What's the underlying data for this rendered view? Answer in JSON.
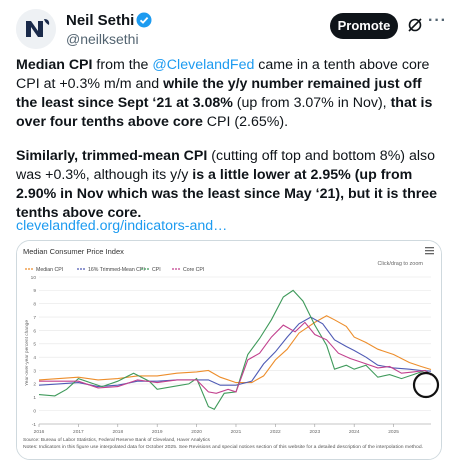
{
  "author": {
    "name": "Neil Sethi",
    "handle": "@neilksethi"
  },
  "header": {
    "promote_label": "Promote",
    "more_label": "···",
    "grok_icon": "grok-icon",
    "verified_color": "#1d9bf0"
  },
  "tweet": {
    "p1": [
      {
        "t": "Median CPI",
        "b": true
      },
      {
        "t": " from the "
      },
      {
        "t": "@ClevelandFed",
        "link": true
      },
      {
        "t": " came in a tenth above core CPI at +0.3% m/m and "
      },
      {
        "t": "while the y/y number remained just off the least since Sept ‘21 at 3.08%",
        "b": true
      },
      {
        "t": " (up from 3.07% in Nov), "
      },
      {
        "t": "that is over four tenths above core",
        "b": true
      },
      {
        "t": " CPI (2.65%)."
      }
    ],
    "p2": [
      {
        "t": "Similarly, trimmed-mean CPI",
        "b": true
      },
      {
        "t": " (cutting off top and bottom 8%) also was +0.3%, although its y/y "
      },
      {
        "t": "is a little lower at 2.95% (up from 2.90% in Nov which was the least since May ‘21), but it is three tenths above core.",
        "b": true
      }
    ],
    "link_text": "clevelandfed.org/indicators-and…"
  },
  "chart": {
    "title": "Median Consumer Price Index",
    "menu_icon": "hamburger-menu-icon",
    "zoom_hint": "Click/drag to zoom",
    "ylabel": "Year-over-year percent change",
    "source_line1": "Source: Bureau of Labor Statistics, Federal Reserve Bank of Cleveland, Haver Analytics",
    "source_line2": "Notes: Indicators in this figure use interpolated data for October 2025. See Revisions and special notices section of this website for a detailed description of the interpolation method."
  },
  "chart_data": {
    "type": "line",
    "title": "Median Consumer Price Index",
    "ylabel": "Year-over-year percent change",
    "ylim": [
      -1,
      10
    ],
    "y_ticks": [
      -1,
      0,
      1,
      2,
      3,
      4,
      5,
      6,
      7,
      8,
      9,
      10
    ],
    "xlim": [
      2016,
      2025.95
    ],
    "x_ticks": [
      "2016",
      "2017",
      "2018",
      "2019",
      "2020",
      "2021",
      "2022",
      "2023",
      "2024",
      "2025"
    ],
    "legend_position": "top-left",
    "grid": true,
    "series": [
      {
        "name": "Median CPI",
        "color": "#ed8e2c",
        "points": [
          [
            2016,
            2.3
          ],
          [
            2016.5,
            2.4
          ],
          [
            2017,
            2.5
          ],
          [
            2017.5,
            2.3
          ],
          [
            2018,
            2.4
          ],
          [
            2018.5,
            2.6
          ],
          [
            2019,
            2.6
          ],
          [
            2019.5,
            2.8
          ],
          [
            2020,
            2.9
          ],
          [
            2020.3,
            3.0
          ],
          [
            2020.6,
            2.5
          ],
          [
            2021,
            2.1
          ],
          [
            2021.4,
            2.1
          ],
          [
            2021.7,
            2.6
          ],
          [
            2022,
            3.8
          ],
          [
            2022.3,
            4.6
          ],
          [
            2022.6,
            5.8
          ],
          [
            2023,
            6.6
          ],
          [
            2023.3,
            7.1
          ],
          [
            2023.5,
            6.8
          ],
          [
            2023.8,
            6.3
          ],
          [
            2024,
            5.5
          ],
          [
            2024.3,
            5.1
          ],
          [
            2024.6,
            4.6
          ],
          [
            2025,
            4.2
          ],
          [
            2025.4,
            3.6
          ],
          [
            2025.7,
            3.3
          ],
          [
            2025.95,
            3.08
          ]
        ]
      },
      {
        "name": "16% Trimmed-Mean CPI",
        "color": "#4f5bb5",
        "points": [
          [
            2016,
            1.9
          ],
          [
            2016.5,
            2.0
          ],
          [
            2017,
            2.1
          ],
          [
            2017.5,
            1.8
          ],
          [
            2018,
            1.9
          ],
          [
            2018.5,
            2.2
          ],
          [
            2019,
            2.2
          ],
          [
            2019.5,
            2.3
          ],
          [
            2020,
            2.3
          ],
          [
            2020.3,
            2.3
          ],
          [
            2020.6,
            1.9
          ],
          [
            2021,
            1.9
          ],
          [
            2021.4,
            2.2
          ],
          [
            2021.7,
            3.5
          ],
          [
            2022,
            4.4
          ],
          [
            2022.3,
            5.5
          ],
          [
            2022.6,
            6.5
          ],
          [
            2022.9,
            7.0
          ],
          [
            2023.2,
            6.5
          ],
          [
            2023.5,
            5.3
          ],
          [
            2023.8,
            4.8
          ],
          [
            2024,
            4.5
          ],
          [
            2024.3,
            4.0
          ],
          [
            2024.6,
            3.4
          ],
          [
            2025,
            3.2
          ],
          [
            2025.4,
            3.1
          ],
          [
            2025.7,
            3.0
          ],
          [
            2025.95,
            2.95
          ]
        ]
      },
      {
        "name": "CPI",
        "color": "#3f9a5b",
        "points": [
          [
            2016,
            1.2
          ],
          [
            2016.4,
            1.1
          ],
          [
            2016.7,
            1.6
          ],
          [
            2017,
            2.4
          ],
          [
            2017.3,
            2.1
          ],
          [
            2017.6,
            1.8
          ],
          [
            2018,
            2.2
          ],
          [
            2018.4,
            2.8
          ],
          [
            2018.8,
            2.2
          ],
          [
            2019,
            1.6
          ],
          [
            2019.4,
            1.8
          ],
          [
            2019.8,
            2.0
          ],
          [
            2020,
            2.4
          ],
          [
            2020.3,
            0.3
          ],
          [
            2020.45,
            0.1
          ],
          [
            2020.7,
            1.3
          ],
          [
            2021,
            1.4
          ],
          [
            2021.3,
            4.2
          ],
          [
            2021.6,
            5.4
          ],
          [
            2021.9,
            6.8
          ],
          [
            2022.2,
            8.5
          ],
          [
            2022.45,
            9.0
          ],
          [
            2022.7,
            8.2
          ],
          [
            2023,
            6.4
          ],
          [
            2023.3,
            4.9
          ],
          [
            2023.5,
            3.1
          ],
          [
            2023.8,
            3.4
          ],
          [
            2024,
            3.1
          ],
          [
            2024.3,
            3.4
          ],
          [
            2024.6,
            2.5
          ],
          [
            2024.9,
            2.7
          ],
          [
            2025.2,
            2.4
          ],
          [
            2025.5,
            2.7
          ],
          [
            2025.8,
            3.0
          ],
          [
            2025.95,
            2.7
          ]
        ]
      },
      {
        "name": "Core CPI",
        "color": "#c2418e",
        "points": [
          [
            2016,
            2.2
          ],
          [
            2016.5,
            2.2
          ],
          [
            2017,
            2.2
          ],
          [
            2017.5,
            1.7
          ],
          [
            2018,
            1.8
          ],
          [
            2018.5,
            2.3
          ],
          [
            2019,
            2.1
          ],
          [
            2019.5,
            2.3
          ],
          [
            2020,
            2.3
          ],
          [
            2020.3,
            1.4
          ],
          [
            2020.5,
            1.3
          ],
          [
            2020.8,
            1.6
          ],
          [
            2021,
            1.4
          ],
          [
            2021.3,
            3.8
          ],
          [
            2021.6,
            4.3
          ],
          [
            2021.9,
            5.5
          ],
          [
            2022.2,
            6.4
          ],
          [
            2022.5,
            5.9
          ],
          [
            2022.75,
            6.6
          ],
          [
            2023,
            5.7
          ],
          [
            2023.3,
            5.3
          ],
          [
            2023.6,
            4.3
          ],
          [
            2023.9,
            3.9
          ],
          [
            2024.2,
            3.6
          ],
          [
            2024.6,
            3.2
          ],
          [
            2024.9,
            3.3
          ],
          [
            2025.2,
            2.8
          ],
          [
            2025.5,
            2.9
          ],
          [
            2025.8,
            3.0
          ],
          [
            2025.95,
            2.65
          ]
        ]
      }
    ]
  }
}
